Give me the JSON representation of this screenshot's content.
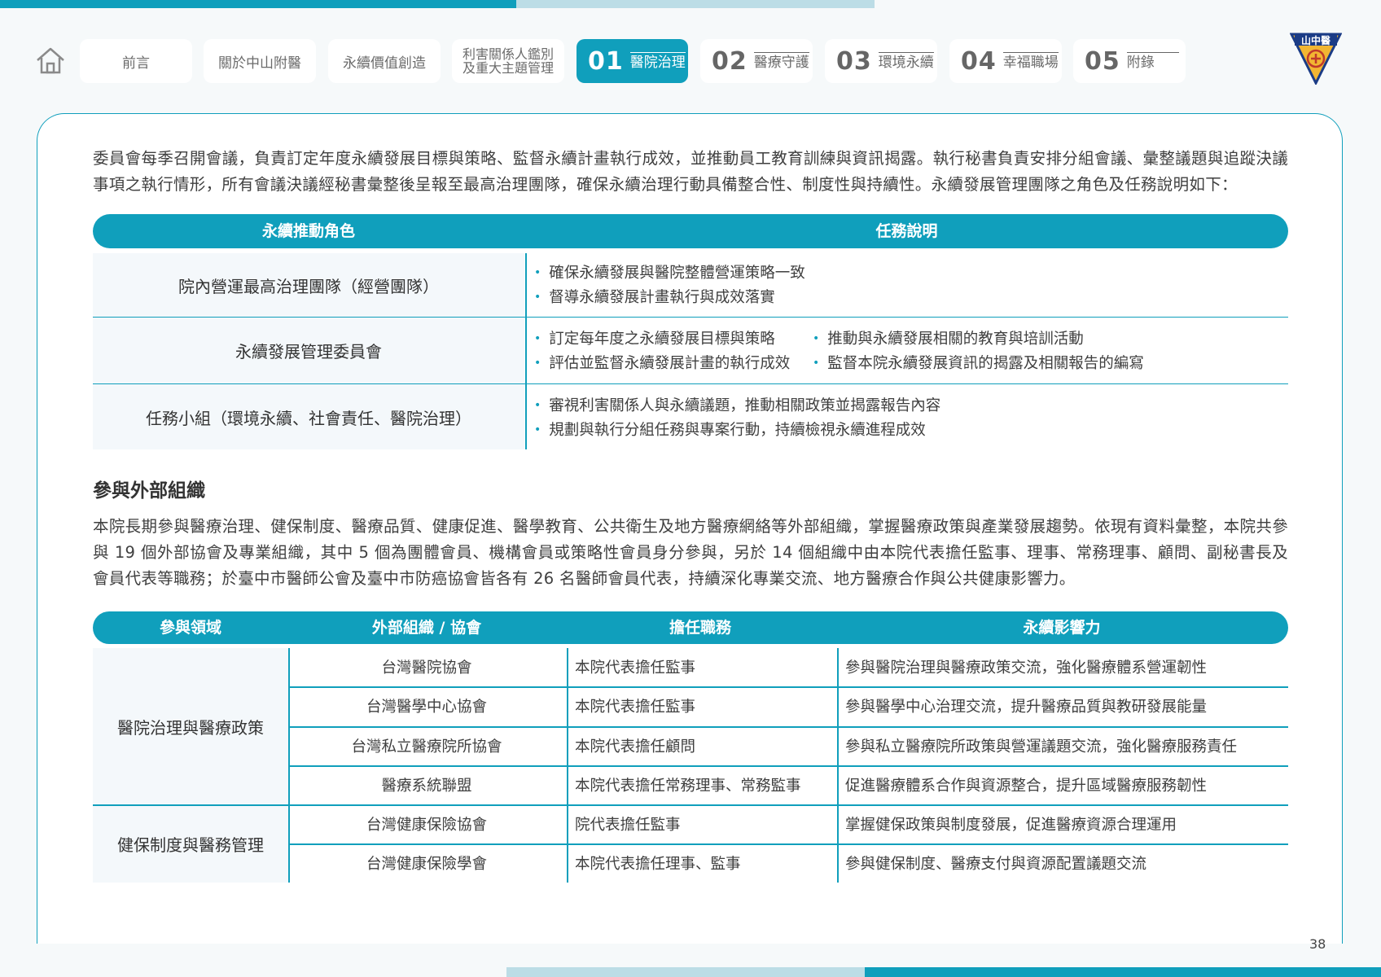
{
  "nav": {
    "tabs": [
      {
        "label": "前言"
      },
      {
        "label": "關於中山附醫"
      },
      {
        "label": "永續價值創造"
      },
      {
        "line1": "利害關係人鑑別",
        "line2": "及重大主題管理"
      },
      {
        "num": "01",
        "label": "醫院治理"
      },
      {
        "num": "02",
        "label": "醫療守護"
      },
      {
        "num": "03",
        "label": "環境永續"
      },
      {
        "num": "04",
        "label": "幸福職場"
      },
      {
        "num": "05",
        "label": "附錄"
      }
    ],
    "logo_text": "山中醫"
  },
  "intro": "委員會每季召開會議，負責訂定年度永續發展目標與策略、監督永續計畫執行成效，並推動員工教育訓練與資訊揭露。執行秘書負責安排分組會議、彙整議題與追蹤決議事項之執行情形，所有會議決議經秘書彙整後呈報至最高治理團隊，確保永續治理行動具備整合性、制度性與持續性。永續發展管理團隊之角色及任務說明如下：",
  "roles_table": {
    "headers": [
      "永續推動角色",
      "任務說明"
    ],
    "rows": [
      {
        "role": "院內營運最高治理團隊（經營團隊）",
        "tasks": [
          "確保永續發展與醫院整體營運策略一致",
          "督導永續發展計畫執行與成效落實"
        ]
      },
      {
        "role": "永續發展管理委員會",
        "tasks": [
          "訂定每年度之永續發展目標與策略",
          "評估並監督永續發展計畫的執行成效",
          "推動與永續發展相關的教育與培訓活動",
          "監督本院永續發展資訊的揭露及相關報告的編寫"
        ]
      },
      {
        "role": "任務小組（環境永續、社會責任、醫院治理）",
        "tasks": [
          "審視利害關係人與永續議題，推動相關政策並揭露報告內容",
          "規劃與執行分組任務與專案行動，持續檢視永續進程成效"
        ]
      }
    ]
  },
  "section_title": "參與外部組織",
  "section_para": "本院長期參與醫療治理、健保制度、醫療品質、健康促進、醫學教育、公共衛生及地方醫療網絡等外部組織，掌握醫療政策與產業發展趨勢。依現有資料彙整，本院共參與 19 個外部協會及專業組織，其中 5 個為團體會員、機構會員或策略性會員身分參與，另於 14 個組織中由本院代表擔任監事、理事、常務理事、顧問、副秘書長及會員代表等職務；於臺中市醫師公會及臺中市防癌協會皆各有 26 名醫師會員代表，持續深化專業交流、地方醫療合作與公共健康影響力。",
  "org_table": {
    "headers": [
      "參與領域",
      "外部組織 / 協會",
      "擔任職務",
      "永續影響力"
    ],
    "categories": [
      "醫院治理與醫療政策",
      "健保制度與醫務管理"
    ],
    "rows": [
      {
        "org": "台灣醫院協會",
        "role": "本院代表擔任監事",
        "impact": "參與醫院治理與醫療政策交流，強化醫療體系營運韌性"
      },
      {
        "org": "台灣醫學中心協會",
        "role": "本院代表擔任監事",
        "impact": "參與醫學中心治理交流，提升醫療品質與教研發展能量"
      },
      {
        "org": "台灣私立醫療院所協會",
        "role": "本院代表擔任顧問",
        "impact": "參與私立醫療院所政策與營運議題交流，強化醫療服務責任"
      },
      {
        "org": "醫療系統聯盟",
        "role": "本院代表擔任常務理事、常務監事",
        "impact": "促進醫療體系合作與資源整合，提升區域醫療服務韌性"
      },
      {
        "org": "台灣健康保險協會",
        "role": "院代表擔任監事",
        "impact": "掌握健保政策與制度發展，促進醫療資源合理運用"
      },
      {
        "org": "台灣健康保險學會",
        "role": "本院代表擔任理事、監事",
        "impact": "參與健保制度、醫療支付與資源配置議題交流"
      }
    ]
  },
  "page_number": "38",
  "colors": {
    "accent": "#109fbc",
    "accent_light": "#bcdde6"
  }
}
